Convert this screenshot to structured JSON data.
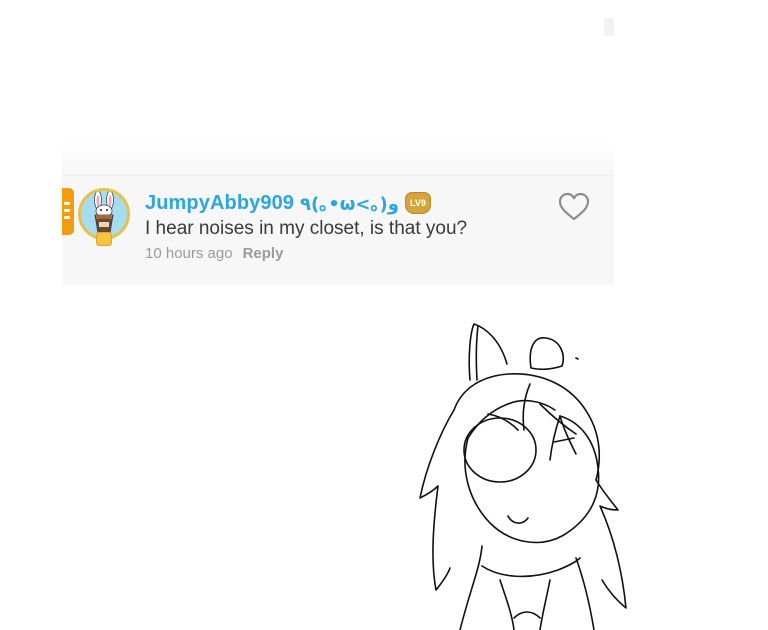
{
  "comment": {
    "username": "JumpyAbby909",
    "kaomoji": "٩(｡•ω<｡)و",
    "level_badge": "LV9",
    "text": "I hear noises in my closet, is that you?",
    "timestamp": "10 hours ago",
    "reply_label": "Reply",
    "username_color": "#2aa6e0",
    "accent_color": "#f39c12",
    "icons": {
      "like": "heart-outline-icon",
      "level": "level-badge-icon",
      "menu": "menu-tab-icon"
    }
  }
}
